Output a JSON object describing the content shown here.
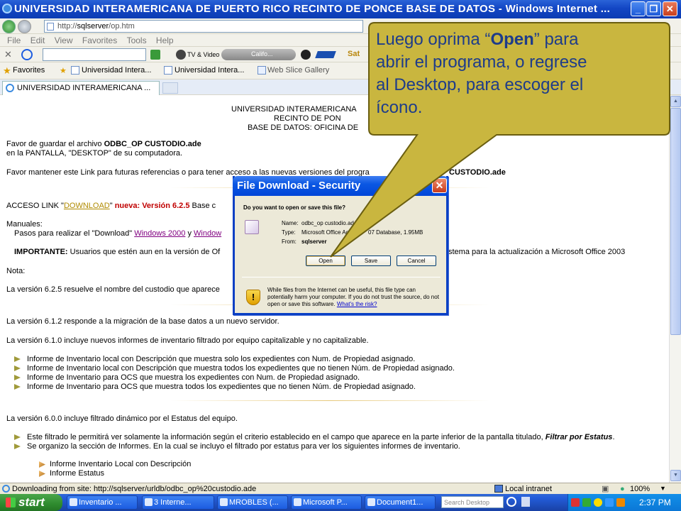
{
  "window": {
    "title": "UNIVERSIDAD INTERAMERICANA DE PUERTO RICO RECINTO DE PONCE BASE DE DATOS - Windows Internet ...",
    "minimize": "_",
    "restore": "❐",
    "close": "✕"
  },
  "address_bar": {
    "prefix": "http://",
    "host": "sqlserver",
    "path": "/op.htm"
  },
  "menu": [
    "File",
    "Edit",
    "View",
    "Favorites",
    "Tools",
    "Help"
  ],
  "links_bar": {
    "tv_video": "TV & Video",
    "califo": "Califo...",
    "sat": "Sat"
  },
  "favorites_bar": {
    "favorites": "Favorites",
    "items": [
      "Universidad Intera...",
      "Universidad Intera...",
      "Web Slice Gallery"
    ]
  },
  "tab": {
    "label": "UNIVERSIDAD INTERAMERICANA ..."
  },
  "page": {
    "header1": "UNIVERSIDAD INTERAMERICANA",
    "header2": "RECINTO DE PON",
    "header3": "BASE DE DATOS: OFICINA DE",
    "save_text_pre": "Favor de guardar el archivo ",
    "save_file": "ODBC_OP CUSTODIO.ade",
    "save_text_2": "en la PANTALLA,  \"DESKTOP\" de su computadora.",
    "keep_link_text": "Favor mantener este Link para futuras referencias o para tener acceso a las nuevas versiones del progra",
    "keep_link_file": "CUSTODIO.ade",
    "access_pre": "ACCESO LINK \"",
    "access_link": "DOWNLOAD",
    "access_mid": "\" ",
    "access_version": "nueva: Versión 6.2.5",
    "access_post": " Base c",
    "manuales": "Manuales:",
    "pasos_pre": "Pasos para realizar el \"Download\" ",
    "win2000": "Windows 2000",
    "pasos_y": " y ",
    "winxp": "Window",
    "importante_label": "IMPORTANTE:",
    "importante_text": " Usuarios que estén aun en la versión de Of",
    "importante_text2": "stema para la actualización a Microsoft Office 2003",
    "nota": "Nota:",
    "v625": "La versión 6.2.5 resuelve el nombre del custodio que aparece",
    "v612": "La versión 6.1.2  responde a la migración de la base datos a un nuevo servidor.",
    "v610": "La versión 6.1.0 incluye nuevos informes de inventario filtrado por equipo capitalizable y no capitalizable.",
    "v610_items": [
      "Informe de Inventario local con Descripción que muestra solo los expedientes con Num. de Propiedad asignado.",
      "Informe de Inventario local con Descripción que muestra todos los expedientes que no tienen Núm. de Propiedad asignado.",
      "Informe de Inventario para OCS que muestra los expedientes con Num. de Propiedad asignado.",
      "Informe de Inventario para OCS que muestra todos los expedientes que no tienen Núm. de Propiedad asignado."
    ],
    "v600": "La versión 6.0.0 incluye filtrado dinámico por el Estatus del equipo.",
    "v600_item1_pre": "Este filtrado le permitirá ver solamente la información según el criterio establecido en el campo que aparece en la parte inferior de la pantalla titulado, ",
    "v600_item1_em": "Filtrar por Estatus",
    "v600_item1_post": ".",
    "v600_item2": "Se organizo la sección de Informes. En la cual se incluyo el filtrado por estatus para ver los siguientes informes de inventario.",
    "sub_items": [
      "Informe Inventario Local con Descripción",
      "Informe Estatus"
    ]
  },
  "dialog": {
    "title": "File Download - Security",
    "close": "✕",
    "question": "Do you want to open or save this file?",
    "name_label": "Name:",
    "name_value": "odbc_op custodio.ade",
    "type_label": "Type:",
    "type_value": "Microsoft Office Ac",
    "type_value2": "07 Database, 1.95MB",
    "from_label": "From:",
    "from_value": "sqlserver",
    "open": "Open",
    "save": "Save",
    "cancel": "Cancel",
    "warning1": "While files from the Internet can be useful, this file type can",
    "warning2": "potentially harm your computer. If you do not trust the source, do not",
    "warning3_pre": "open or save this software. ",
    "warning3_link": "What's the risk?"
  },
  "callout": {
    "line1_pre": "Luego oprima “",
    "line1_bold": "Open",
    "line1_post": "” para",
    "line2": "abrir el programa, o regrese",
    "line3": "al Desktop, para escoger el",
    "line4": "ícono."
  },
  "status_bar": {
    "text": "Downloading from site: http://sqlserver/urldb/odbc_op%20custodio.ade",
    "zone": "Local intranet",
    "zoom": "100%"
  },
  "taskbar": {
    "start": "start",
    "buttons": [
      "Inventario ...",
      "3 Interne...",
      "MROBLES (...",
      "Microsoft P...",
      "Document1..."
    ],
    "search_placeholder": "Search Desktop",
    "clock": "2:37 PM"
  },
  "colors": {
    "callout_fill": "#c9b63f",
    "callout_text": "#1e3c8a",
    "xp_blue": "#0b57e3",
    "link_orange": "#b08a00",
    "version_red": "#c00000"
  }
}
